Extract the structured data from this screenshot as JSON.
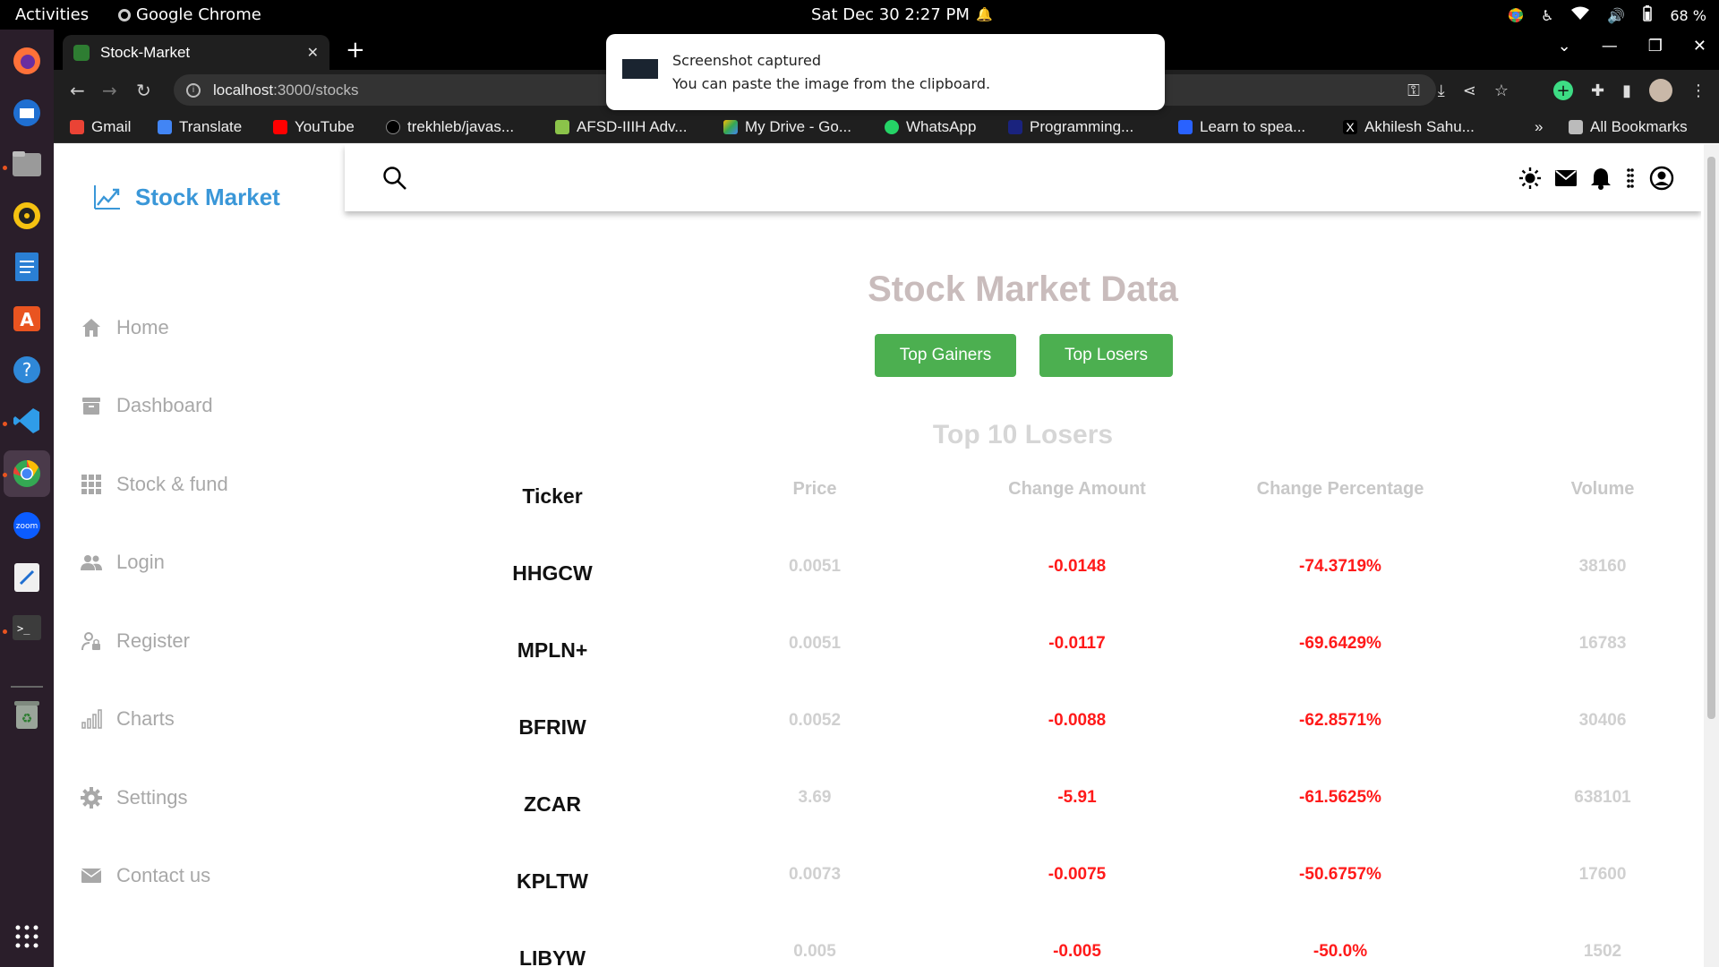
{
  "system_bar": {
    "activities": "Activities",
    "app_name": "Google Chrome",
    "clock": "Sat Dec 30  2:27 PM",
    "battery": "68 %"
  },
  "browser": {
    "tab_title": "Stock-Market",
    "url_host": "localhost",
    "url_path": ":3000/stocks",
    "bookmarks": [
      "Gmail",
      "Translate",
      "YouTube",
      "trekhleb/javas...",
      "AFSD-IIIH Adv...",
      "My Drive - Go...",
      "WhatsApp",
      "Programming...",
      "Learn to spea...",
      "Akhilesh Sahu..."
    ],
    "all_bookmarks": "All Bookmarks"
  },
  "notification": {
    "title": "Screenshot captured",
    "body": "You can paste the image from the clipboard."
  },
  "sidebar": {
    "brand": "Stock Market",
    "items": [
      "Home",
      "Dashboard",
      "Stock & fund",
      "Login",
      "Register",
      "Charts",
      "Settings",
      "Contact us"
    ]
  },
  "main": {
    "title": "Stock Market Data",
    "buttons": {
      "gainers": "Top Gainers",
      "losers": "Top Losers"
    },
    "table_title": "Top 10 Losers",
    "columns": [
      "Ticker",
      "Price",
      "Change Amount",
      "Change Percentage",
      "Volume"
    ],
    "rows": [
      [
        "HHGCW",
        "0.0051",
        "-0.0148",
        "-74.3719%",
        "38160"
      ],
      [
        "MPLN+",
        "0.0051",
        "-0.0117",
        "-69.6429%",
        "16783"
      ],
      [
        "BFRIW",
        "0.0052",
        "-0.0088",
        "-62.8571%",
        "30406"
      ],
      [
        "ZCAR",
        "3.69",
        "-5.91",
        "-61.5625%",
        "638101"
      ],
      [
        "KPLTW",
        "0.0073",
        "-0.0075",
        "-50.6757%",
        "17600"
      ],
      [
        "LIBYW",
        "0.005",
        "-0.005",
        "-50.0%",
        "1502"
      ]
    ]
  },
  "colors": {
    "brand": "#3a97d8",
    "button": "#4caf50",
    "negative": "#ff1a1a"
  }
}
